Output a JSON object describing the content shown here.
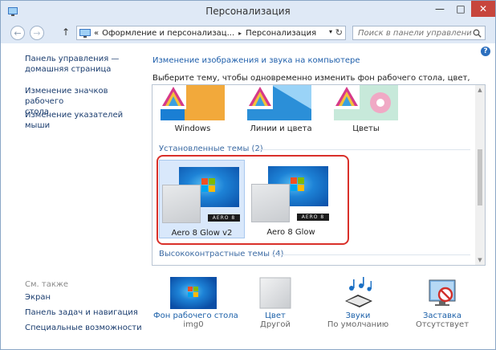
{
  "window": {
    "title": "Персонализация"
  },
  "controls": {
    "minimize": "—",
    "maximize": "□",
    "close": "✕"
  },
  "nav": {
    "back": "←",
    "forward": "→",
    "up": "↑",
    "breadcrumb": {
      "prefix": "«",
      "root": "Оформление и персонализац...",
      "separator": "▸",
      "current": "Персонализация"
    },
    "dropdown": "▾",
    "refresh": "↻",
    "search_placeholder": "Поиск в панели управления"
  },
  "help": "?",
  "sidebar": {
    "links": [
      {
        "text": "Панель управления —\nдомашняя страница"
      },
      {
        "text": "Изменение значков рабочего\nстола"
      },
      {
        "text": "Изменение указателей мыши"
      }
    ],
    "see_also": "См. также",
    "see_also_links": [
      {
        "text": "Экран"
      },
      {
        "text": "Панель задач и навигация"
      },
      {
        "text": "Специальные возможности"
      }
    ]
  },
  "main": {
    "title": "Изменение изображения и звука на компьютере",
    "instructions": "Выберите тему, чтобы одновременно изменить фон рабочего стола, цвет, звуки и заставку.",
    "default_themes": [
      {
        "label": "Windows"
      },
      {
        "label": "Линии и цвета"
      },
      {
        "label": "Цветы"
      }
    ],
    "installed_header": "Установленные темы (2)",
    "installed_themes": [
      {
        "label": "Aero 8 Glow v2",
        "badge": "AERO 8",
        "selected": true
      },
      {
        "label": "Aero 8 Glow",
        "badge": "AERO 8",
        "selected": false
      }
    ],
    "high_contrast_header": "Высококонтрастные темы (4)"
  },
  "bottom": [
    {
      "label": "Фон рабочего стола",
      "sub": "img0",
      "icon": "desktop-background-icon"
    },
    {
      "label": "Цвет",
      "sub": "Другой",
      "icon": "color-swatch-icon"
    },
    {
      "label": "Звуки",
      "sub": "По умолчанию",
      "icon": "sounds-icon"
    },
    {
      "label": "Заставка",
      "sub": "Отсутствует",
      "icon": "screensaver-icon"
    }
  ],
  "colors": {
    "accent": "#1f5fab",
    "selection": "#d9e8fb",
    "highlight_border": "#d9302a"
  }
}
